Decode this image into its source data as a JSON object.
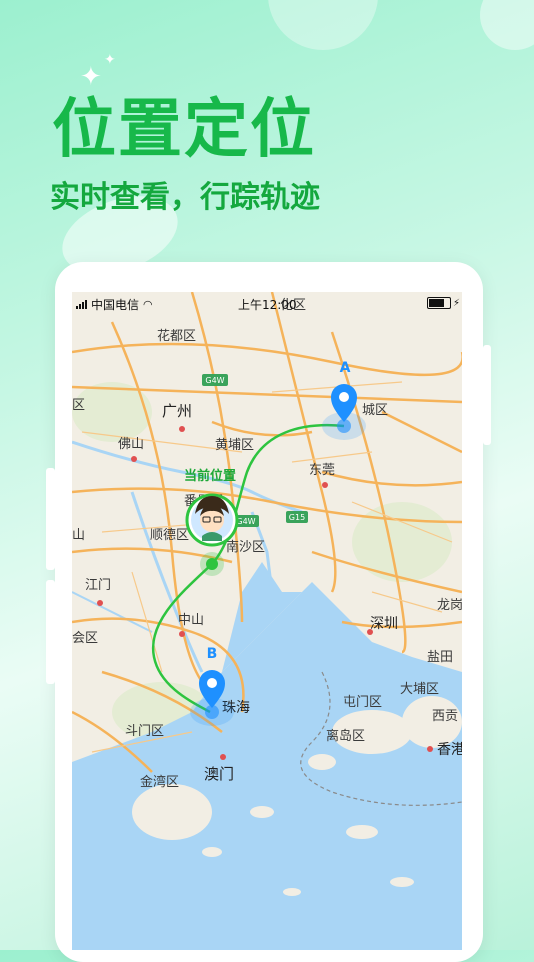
{
  "promo": {
    "title": "位置定位",
    "subtitle": "实时查看，行踪轨迹"
  },
  "status_bar": {
    "carrier": "中国电信",
    "time": "上午12:00"
  },
  "map": {
    "current_location_label": "当前位置",
    "marker_a_label": "A",
    "marker_b_label": "B",
    "places": {
      "huadu": "花都区",
      "guangzhou": "广州",
      "foshan": "佛山",
      "huangpu": "黄埔区",
      "panyu": "番禺区",
      "shunde": "顺德区",
      "nansha": "南沙区",
      "dongguan": "东莞",
      "jiangmen": "江门",
      "zhongshan": "中山",
      "shenzhen": "深圳",
      "longgang": "龙岗",
      "yantian": "盐田",
      "tuenmun": "屯门区",
      "taipo": "大埔区",
      "saikung": "西贡",
      "islands": "离岛区",
      "hongkong": "香港",
      "zhuhai": "珠海",
      "doumen": "斗门区",
      "macau": "澳门",
      "jinwan": "金湾区",
      "xinhui": "会区",
      "left_qu": "区",
      "cong_qu": "化区",
      "cheng_qu": "城区",
      "left_shan": "山"
    },
    "road_shields": {
      "g4w_top": "G4W",
      "g4w_mid": "G4W",
      "g15": "G15"
    },
    "colors": {
      "route": "#2ec43f",
      "marker": "#1e90ff",
      "water": "#a9d5f5",
      "road": "#f5b35a"
    }
  }
}
